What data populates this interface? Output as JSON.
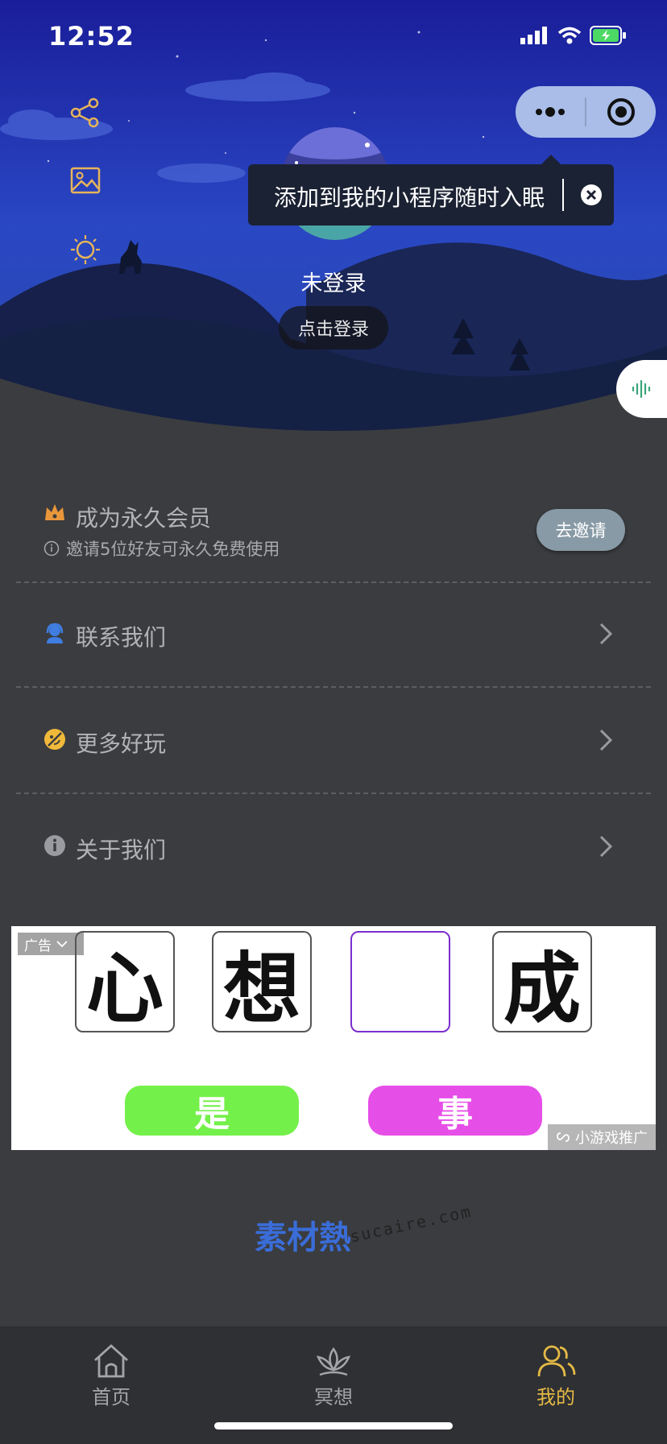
{
  "status_bar": {
    "time": "12:52"
  },
  "colors": {
    "accent": "#e4b945",
    "sky_top": "#1a1d99",
    "menu_bg": "#3b3c3f",
    "invite_button": "#889aa6"
  },
  "capsule": {
    "more_icon": "ellipsis-icon",
    "close_icon": "target-icon"
  },
  "side_icons": [
    "share-icon",
    "image-icon",
    "sun-icon"
  ],
  "tooltip": {
    "text": "添加到我的小程序随时入眠"
  },
  "profile": {
    "nickname": "未登录",
    "login_label": "点击登录"
  },
  "member": {
    "title": "成为永久会员",
    "subtitle": "邀请5位好友可永久免费使用",
    "invite_label": "去邀请"
  },
  "menu": [
    {
      "label": "联系我们",
      "icon": "headset-icon"
    },
    {
      "label": "更多好玩",
      "icon": "smile-icon"
    },
    {
      "label": "关于我们",
      "icon": "info-icon"
    }
  ],
  "ad": {
    "label": "广告",
    "chars": [
      "心",
      "想",
      "",
      "成"
    ],
    "options": [
      "是",
      "事"
    ],
    "source": "小游戏推广"
  },
  "watermark": {
    "logo": "素材熱",
    "url": "sucaire.com"
  },
  "tabs": [
    {
      "label": "首页",
      "icon": "home-icon",
      "active": false
    },
    {
      "label": "冥想",
      "icon": "lotus-icon",
      "active": false
    },
    {
      "label": "我的",
      "icon": "user-icon",
      "active": true
    }
  ]
}
